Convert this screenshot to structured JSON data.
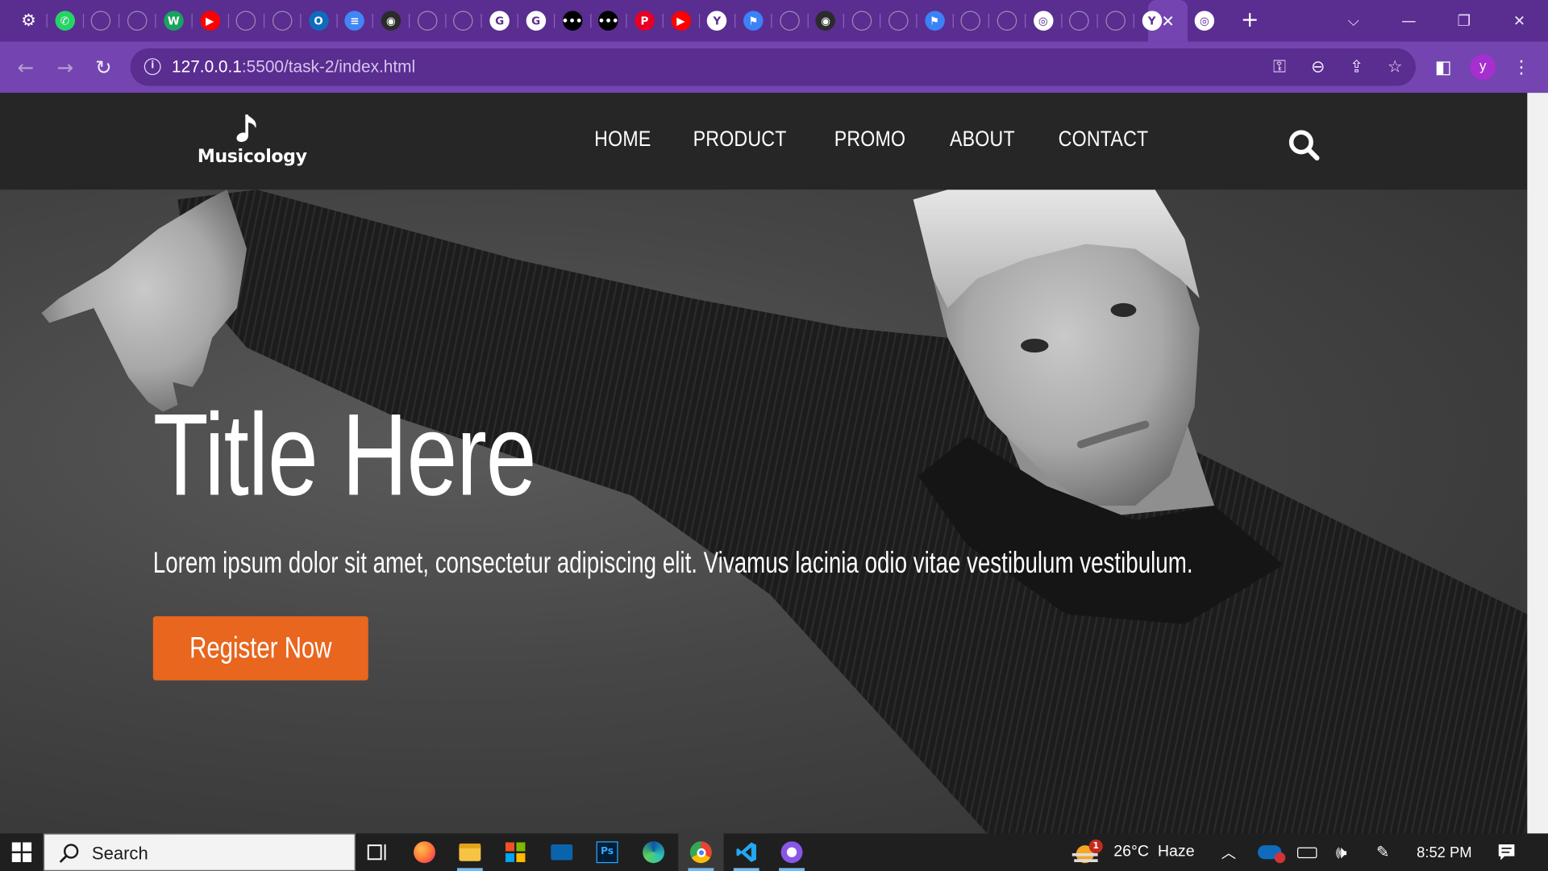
{
  "browser": {
    "tab_icons": [
      {
        "name": "settings",
        "color": "#ffffff",
        "glyph": "⚙"
      },
      {
        "name": "whatsapp",
        "color": "#25d366",
        "glyph": "✆"
      },
      {
        "name": "globe",
        "color": "#9a8ab5",
        "glyph": ""
      },
      {
        "name": "globe",
        "color": "#9a8ab5",
        "glyph": ""
      },
      {
        "name": "w-app",
        "color": "#1aa260",
        "glyph": "W"
      },
      {
        "name": "youtube",
        "color": "#ff0000",
        "glyph": "▶"
      },
      {
        "name": "globe",
        "color": "#9a8ab5",
        "glyph": ""
      },
      {
        "name": "globe",
        "color": "#9a8ab5",
        "glyph": ""
      },
      {
        "name": "outlook",
        "color": "#0f6cbd",
        "glyph": "O"
      },
      {
        "name": "docs",
        "color": "#4285f4",
        "glyph": "≡"
      },
      {
        "name": "github",
        "color": "#2b2b2b",
        "glyph": "◉"
      },
      {
        "name": "globe",
        "color": "#9a8ab5",
        "glyph": ""
      },
      {
        "name": "globe",
        "color": "#9a8ab5",
        "glyph": ""
      },
      {
        "name": "google",
        "color": "#ffffff",
        "glyph": "G"
      },
      {
        "name": "google",
        "color": "#ffffff",
        "glyph": "G"
      },
      {
        "name": "dots",
        "color": "#000000",
        "glyph": "•••"
      },
      {
        "name": "dots",
        "color": "#000000",
        "glyph": "•••"
      },
      {
        "name": "pinterest",
        "color": "#e60023",
        "glyph": "P"
      },
      {
        "name": "youtube",
        "color": "#ff0000",
        "glyph": "▶"
      },
      {
        "name": "y-logo",
        "color": "#ffffff",
        "glyph": "Y"
      },
      {
        "name": "flag",
        "color": "#3b82f6",
        "glyph": "⚑"
      },
      {
        "name": "globe",
        "color": "#9a8ab5",
        "glyph": ""
      },
      {
        "name": "github",
        "color": "#2b2b2b",
        "glyph": "◉"
      },
      {
        "name": "globe",
        "color": "#9a8ab5",
        "glyph": ""
      },
      {
        "name": "globe",
        "color": "#9a8ab5",
        "glyph": ""
      },
      {
        "name": "flag",
        "color": "#3b82f6",
        "glyph": "⚑"
      },
      {
        "name": "globe",
        "color": "#9a8ab5",
        "glyph": ""
      },
      {
        "name": "globe",
        "color": "#9a8ab5",
        "glyph": ""
      },
      {
        "name": "chrome",
        "color": "#ffffff",
        "glyph": "◎"
      },
      {
        "name": "globe",
        "color": "#9a8ab5",
        "glyph": ""
      },
      {
        "name": "globe",
        "color": "#9a8ab5",
        "glyph": ""
      },
      {
        "name": "y-logo",
        "color": "#ffffff",
        "glyph": "Y"
      }
    ],
    "active_tab_close": "✕",
    "after_active_icon": {
      "name": "chrome",
      "glyph": "◎"
    },
    "new_tab": "+",
    "url_host": "127.0.0.1",
    "url_path": ":5500/task-2/index.html",
    "profile_initial": "y",
    "accent": "#7445b0",
    "tabstrip_color": "#5a2d91"
  },
  "site": {
    "logo_text": "Musicology",
    "nav": [
      "HOME",
      "PRODUCT",
      "PROMO",
      "ABOUT",
      "CONTACT"
    ],
    "hero": {
      "title": "Title Here",
      "subtitle": "Lorem ipsum dolor sit amet, consectetur adipiscing elit. Vivamus lacinia odio vitae vestibulum vestibulum.",
      "cta": "Register Now"
    },
    "colors": {
      "header_bg": "#262626",
      "cta_bg": "#e8661e"
    }
  },
  "taskbar": {
    "search_placeholder": "Search",
    "weather": "26°C  Haze",
    "weather_badge": "1",
    "time": "8:52 PM"
  }
}
